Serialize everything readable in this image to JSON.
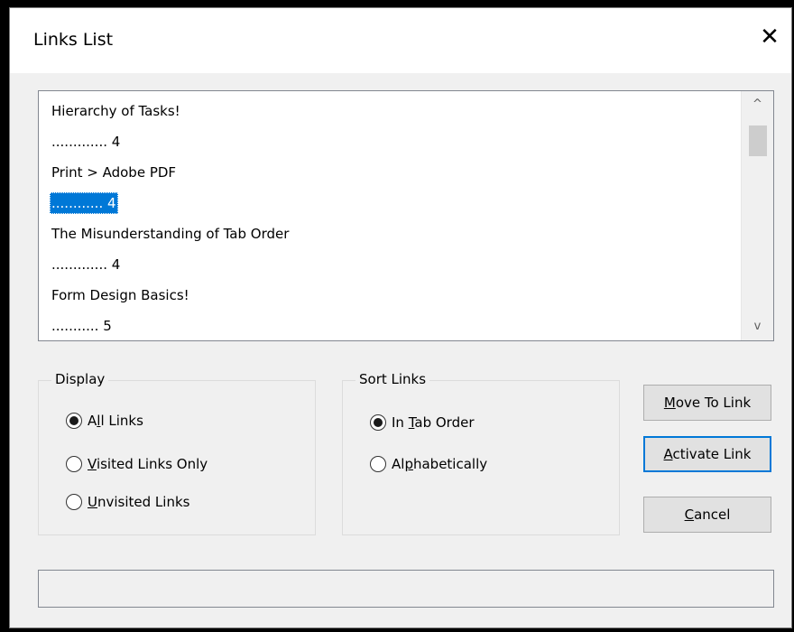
{
  "window": {
    "title": "Links List",
    "close_glyph": "✕"
  },
  "links": [
    {
      "text": "Hierarchy of Tasks!",
      "selected": false
    },
    {
      "text": "............. 4",
      "selected": false
    },
    {
      "text": "Print > Adobe PDF",
      "selected": false
    },
    {
      "text": "............ 4",
      "selected": true
    },
    {
      "text": "The Misunderstanding of Tab Order",
      "selected": false
    },
    {
      "text": "............. 4",
      "selected": false
    },
    {
      "text": "Form Design Basics!",
      "selected": false
    },
    {
      "text": "........... 5",
      "selected": false
    }
  ],
  "scrollbar": {
    "up_icon": "chevron-up-icon",
    "down_icon": "chevron-down-icon",
    "up_glyph": "^",
    "down_glyph": "v"
  },
  "display_group": {
    "label": "Display",
    "options": [
      {
        "pre": "A",
        "key": "l",
        "post": "l Links",
        "checked": true
      },
      {
        "pre": "",
        "key": "V",
        "post": "isited Links Only",
        "checked": false
      },
      {
        "pre": "",
        "key": "U",
        "post": "nvisited Links",
        "checked": false
      }
    ]
  },
  "sort_group": {
    "label": "Sort Links",
    "options": [
      {
        "pre": "In ",
        "key": "T",
        "post": "ab Order",
        "checked": true
      },
      {
        "pre": "Al",
        "key": "p",
        "post": "habetically",
        "checked": false
      }
    ]
  },
  "buttons": {
    "move": {
      "pre": "",
      "key": "M",
      "post": "ove To Link"
    },
    "activate": {
      "pre": "",
      "key": "A",
      "post": "ctivate Link"
    },
    "cancel": {
      "pre": "",
      "key": "C",
      "post": "ancel"
    }
  },
  "colors": {
    "selection": "#0078d7",
    "dialog_bg": "#f0f0f0",
    "default_button_border": "#0078d7"
  }
}
